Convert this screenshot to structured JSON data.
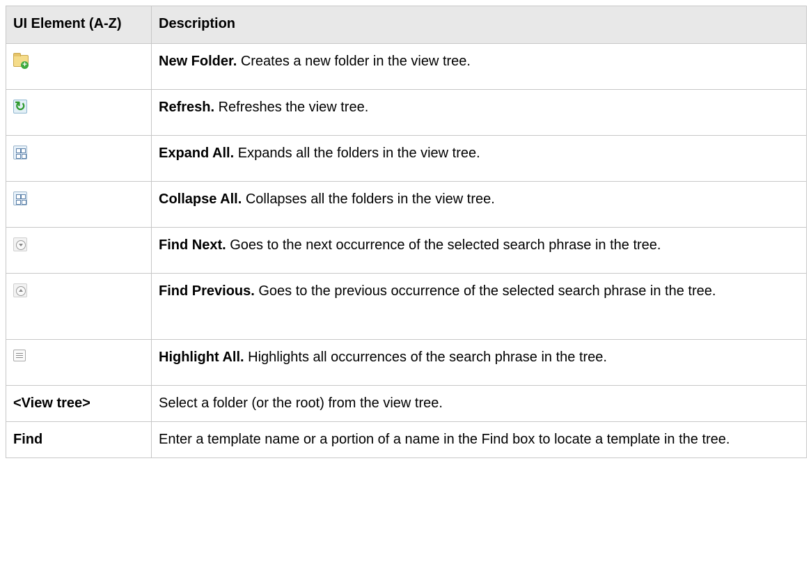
{
  "header": {
    "col1": "UI Element (A-Z)",
    "col2": "Description"
  },
  "rows": [
    {
      "icon": "new-folder-icon",
      "term": "New Folder.",
      "text": "Creates a new folder in the view tree."
    },
    {
      "icon": "refresh-icon",
      "term": "Refresh.",
      "text": "Refreshes the view tree."
    },
    {
      "icon": "expand-all-icon",
      "term": "Expand All.",
      "text": "Expands all the folders in the view tree."
    },
    {
      "icon": "collapse-all-icon",
      "term": "Collapse All.",
      "text": "Collapses all the folders in the view tree."
    },
    {
      "icon": "find-next-icon",
      "term": "Find Next.",
      "text": "Goes to the next occurrence of the selected search phrase in the tree."
    },
    {
      "icon": "find-previous-icon",
      "term": "Find Previous.",
      "text": "Goes to the previous occurrence of the selected search phrase in the tree."
    },
    {
      "icon": "highlight-all-icon",
      "term": "Highlight All.",
      "text": "Highlights all occurrences of the search phrase in the tree."
    },
    {
      "element": "<View tree>",
      "text": "Select a folder (or the root) from the view tree."
    },
    {
      "element": "Find",
      "text": "Enter a template name or a portion of a name in the Find box to locate a template in the tree."
    }
  ]
}
